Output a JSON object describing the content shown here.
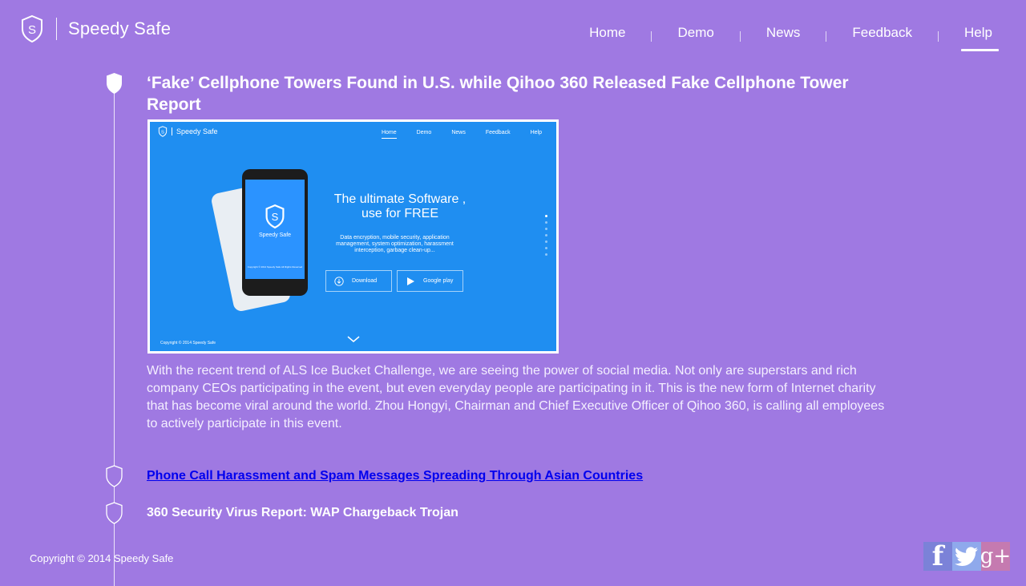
{
  "header": {
    "brand": "Speedy Safe",
    "logo_icon": "shield-s-icon"
  },
  "nav": {
    "items": [
      "Home",
      "Demo",
      "News",
      "Feedback",
      "Help"
    ],
    "active": "Help"
  },
  "article": {
    "title": "‘Fake’ Cellphone Towers Found in U.S. while Qihoo 360 Released Fake Cellphone Tower Report",
    "body": "With the recent trend of ALS Ice Bucket Challenge, we are seeing the power of social media. Not only are superstars and rich company CEOs participating in the event, but even everyday people are participating in it. This is the new form of Internet charity that has become viral around the world. Zhou Hongyi, Chairman and Chief Executive Officer of Qihoo 360, is calling all employees to actively participate in this event."
  },
  "screenshot": {
    "brand": "Speedy Safe",
    "nav": [
      "Home",
      "Demo",
      "News",
      "Feedback",
      "Help"
    ],
    "headline_line1": "The ultimate Software ,",
    "headline_line2": "use for FREE",
    "description": "Data encryption, mobile security, application management, system optimization, harassment interception, garbage clean-up...",
    "phone_app_name": "Speedy Safe",
    "phone_copyright": "Copyright © 2014 Speedy Safe All Rights Reserved",
    "download_label": "Download",
    "google_play_label": "Google play",
    "copyright": "Copyright © 2014  Speedy Safe",
    "background_color": "#1f8ef1"
  },
  "news": [
    "Phone Call Harassment and Spam Messages Spreading Through Asian Countries",
    "360 Security Virus Report: WAP Chargeback Trojan"
  ],
  "footer": {
    "copyright": "Copyright © 2014  Speedy Safe"
  },
  "social": {
    "facebook": "f",
    "twitter_icon": "twitter-bird-icon",
    "google_plus": "g+"
  },
  "colors": {
    "background": "#9f79e2",
    "facebook": "#7b82d8",
    "twitter": "#8fa9ec",
    "google_plus": "#c57ab0"
  }
}
